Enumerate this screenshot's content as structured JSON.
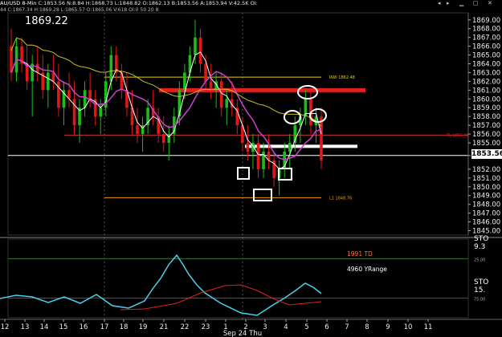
{
  "header": {
    "symbol": "AU/USD 8-Min",
    "ohlc": "C:1853.56  N:8.84  H:1868.73  L:1848.82  O:1862.13  B:1853.56  A:1853.94  V:42.5K  OI:",
    "sub": "44  C:1867.34  H:1869.28  L:1865.57  O:1865.06  V:618  OI:0  50  20  8"
  },
  "price_label": "1869.22",
  "current_price": "1853.56",
  "levels": [
    {
      "label": "RWI 1862.48",
      "value": 1862.48,
      "color": "#e8d000"
    },
    {
      "label": "TL 1855.88",
      "value": 1855.88,
      "color": "#cc3030"
    },
    {
      "label": "L1 1848.76",
      "value": 1848.76,
      "color": "#e8a000"
    }
  ],
  "indicator": {
    "line1": "1991 TD",
    "line1_color": "#ff7030",
    "line2": "4960 YRange",
    "line2_color": "#ffffff",
    "sto_label_top": "STO",
    "sto_value_top": "9.3",
    "sto_label": "STO",
    "sto_value": "15.",
    "levels": [
      "25.00",
      "75.00"
    ]
  },
  "price_axis": [
    "1869.00",
    "1868.00",
    "1867.00",
    "1866.00",
    "1865.00",
    "1864.00",
    "1863.00",
    "1862.00",
    "1861.00",
    "1860.00",
    "1859.00",
    "1858.00",
    "1857.00",
    "1856.00",
    "1855.00",
    "1853.56",
    "1852.00",
    "1851.00",
    "1850.00",
    "1849.00",
    "1848.00",
    "1847.00",
    "1846.00",
    "1845.00"
  ],
  "time_axis": [
    "12",
    "13",
    "14",
    "15",
    "16",
    "17",
    "18",
    "19",
    "21",
    "22",
    "23",
    "1",
    "2",
    "3",
    "4",
    "5",
    "6",
    "7",
    "8",
    "9",
    "10",
    "11"
  ],
  "date_label": "Sep 24 Thu",
  "chart_data": {
    "type": "candlestick",
    "ylim": [
      1844.5,
      1869.8
    ],
    "candles": [
      [
        1866,
        1868,
        1862,
        1863
      ],
      [
        1863,
        1867,
        1862,
        1866
      ],
      [
        1866,
        1867,
        1863,
        1864
      ],
      [
        1864,
        1866,
        1861,
        1862
      ],
      [
        1862,
        1865,
        1858,
        1864
      ],
      [
        1864,
        1866,
        1862,
        1863
      ],
      [
        1863,
        1865,
        1860,
        1861
      ],
      [
        1861,
        1864,
        1859,
        1863
      ],
      [
        1863,
        1865,
        1861,
        1862
      ],
      [
        1862,
        1864,
        1858,
        1859
      ],
      [
        1859,
        1862,
        1857,
        1861
      ],
      [
        1861,
        1863,
        1859,
        1860
      ],
      [
        1860,
        1862,
        1856,
        1857
      ],
      [
        1857,
        1860,
        1855,
        1859
      ],
      [
        1859,
        1862,
        1858,
        1861
      ],
      [
        1861,
        1863,
        1859,
        1860
      ],
      [
        1860,
        1861,
        1857,
        1858
      ],
      [
        1858,
        1860,
        1856,
        1859
      ],
      [
        1859,
        1863,
        1858,
        1862
      ],
      [
        1862,
        1866,
        1861,
        1865
      ],
      [
        1865,
        1866,
        1862,
        1863
      ],
      [
        1863,
        1864,
        1860,
        1861
      ],
      [
        1861,
        1863,
        1858,
        1859
      ],
      [
        1859,
        1861,
        1856,
        1857
      ],
      [
        1857,
        1859,
        1855,
        1856
      ],
      [
        1856,
        1858,
        1854,
        1857
      ],
      [
        1857,
        1860,
        1856,
        1859
      ],
      [
        1859,
        1861,
        1857,
        1858
      ],
      [
        1858,
        1859,
        1855,
        1856
      ],
      [
        1856,
        1858,
        1854,
        1855
      ],
      [
        1855,
        1857,
        1853,
        1856
      ],
      [
        1856,
        1859,
        1855,
        1858
      ],
      [
        1858,
        1862,
        1857,
        1861
      ],
      [
        1861,
        1864,
        1860,
        1863
      ],
      [
        1863,
        1866,
        1862,
        1865
      ],
      [
        1865,
        1869,
        1864,
        1867
      ],
      [
        1867,
        1868,
        1863,
        1864
      ],
      [
        1864,
        1865,
        1861,
        1862
      ],
      [
        1862,
        1864,
        1860,
        1861
      ],
      [
        1861,
        1863,
        1859,
        1862
      ],
      [
        1862,
        1863,
        1858,
        1859
      ],
      [
        1859,
        1861,
        1857,
        1860
      ],
      [
        1860,
        1862,
        1858,
        1859
      ],
      [
        1859,
        1860,
        1856,
        1857
      ],
      [
        1857,
        1858,
        1854,
        1855
      ],
      [
        1855,
        1857,
        1853,
        1854
      ],
      [
        1854,
        1856,
        1852,
        1855
      ],
      [
        1855,
        1856,
        1851,
        1852
      ],
      [
        1852,
        1855,
        1851,
        1854
      ],
      [
        1854,
        1856,
        1852,
        1853
      ],
      [
        1853,
        1854,
        1850,
        1851
      ],
      [
        1851,
        1853,
        1849,
        1852
      ],
      [
        1852,
        1855,
        1851,
        1854
      ],
      [
        1854,
        1856,
        1852,
        1855
      ],
      [
        1855,
        1858,
        1854,
        1857
      ],
      [
        1857,
        1859,
        1855,
        1858
      ],
      [
        1858,
        1861,
        1857,
        1860
      ],
      [
        1860,
        1861,
        1856,
        1857
      ],
      [
        1857,
        1859,
        1855,
        1858
      ],
      [
        1858,
        1859,
        1852,
        1853
      ]
    ]
  }
}
